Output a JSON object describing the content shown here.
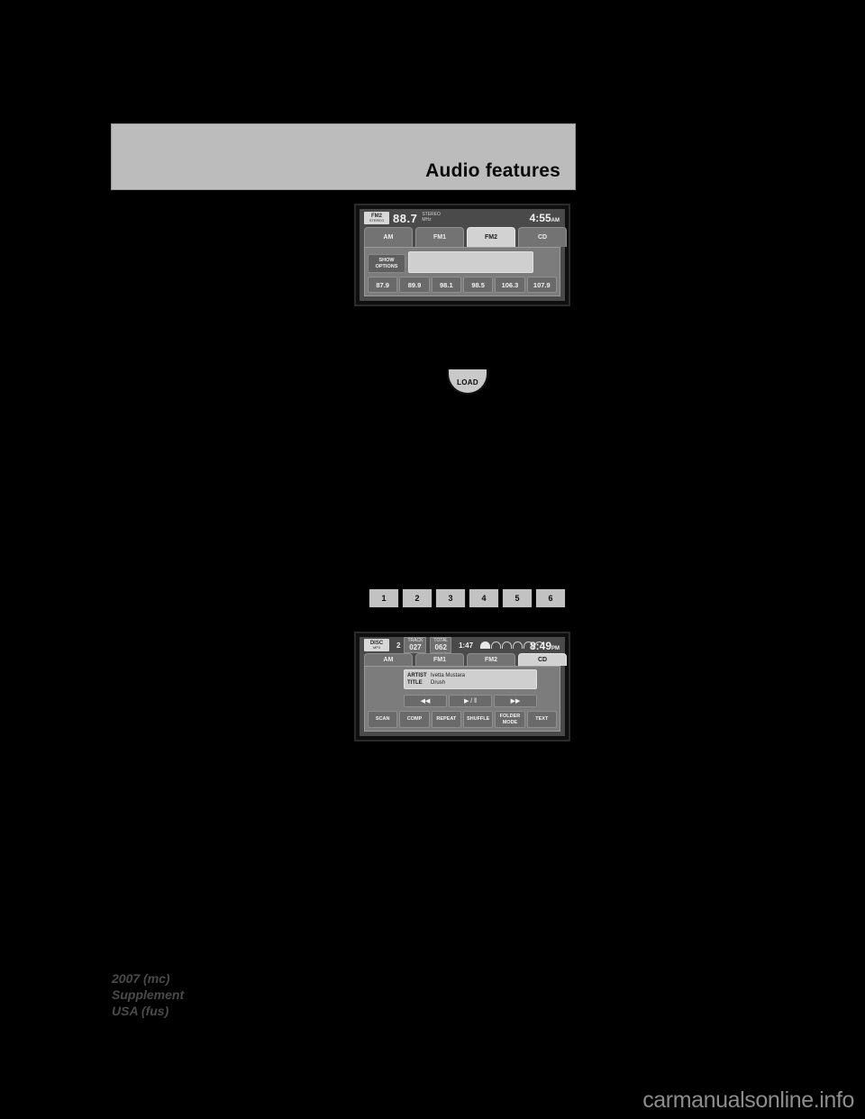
{
  "page": {
    "header_title": "Audio features",
    "background_color": "#000000",
    "header_bg_color": "#bcbcbc"
  },
  "radio_display": {
    "source_badge": "FM2",
    "source_badge_sub": "STEREO",
    "frequency": "88.7",
    "frequency_units_line1": "STEREO",
    "frequency_units_line2": "MHz",
    "clock_time": "4:55",
    "clock_ampm": "AM",
    "tabs": [
      {
        "label": "AM",
        "active": false
      },
      {
        "label": "FM1",
        "active": false
      },
      {
        "label": "FM2",
        "active": true
      },
      {
        "label": "CD",
        "active": false
      }
    ],
    "show_options_line1": "SHOW",
    "show_options_line2": "OPTIONS",
    "presets": [
      "87.9",
      "89.9",
      "98.1",
      "98.5",
      "106.3",
      "107.9"
    ]
  },
  "cd_display": {
    "source_badge": "DISC",
    "source_badge_sub": "MP3",
    "disc_number": "2",
    "track_label": "TRACK",
    "track_value": "027",
    "total_label": "TOTAL",
    "total_value": "062",
    "elapsed_time": "1:47",
    "clock_time": "8:49",
    "clock_ampm": "PM",
    "tabs": [
      {
        "label": "AM",
        "active": false
      },
      {
        "label": "FM1",
        "active": false
      },
      {
        "label": "FM2",
        "active": false
      },
      {
        "label": "CD",
        "active": true
      }
    ],
    "meta": [
      {
        "label": "ARTIST",
        "value": "Ivetta Mustara"
      },
      {
        "label": "TITLE",
        "value": "Drush"
      }
    ],
    "transport": [
      {
        "icon": "rewind-icon",
        "glyph": "◀◀"
      },
      {
        "icon": "play-pause-icon",
        "glyph": "▶ / ‖"
      },
      {
        "icon": "fast-forward-icon",
        "glyph": "▶▶"
      }
    ],
    "function_buttons": [
      {
        "line1": "SCAN",
        "line2": ""
      },
      {
        "line1": "COMP",
        "line2": ""
      },
      {
        "line1": "REPEAT",
        "line2": ""
      },
      {
        "line1": "SHUFFLE",
        "line2": ""
      },
      {
        "line1": "FOLDER",
        "line2": "MODE"
      },
      {
        "line1": "TEXT",
        "line2": ""
      }
    ]
  },
  "load_button": {
    "label": "LOAD"
  },
  "preset_hard_buttons": [
    "1",
    "2",
    "3",
    "4",
    "5",
    "6"
  ],
  "footer": {
    "line1": "2007 (mc)",
    "line2": "Supplement",
    "line3": "USA (fus)"
  },
  "watermark": {
    "text": "carmanualsonline.info"
  }
}
